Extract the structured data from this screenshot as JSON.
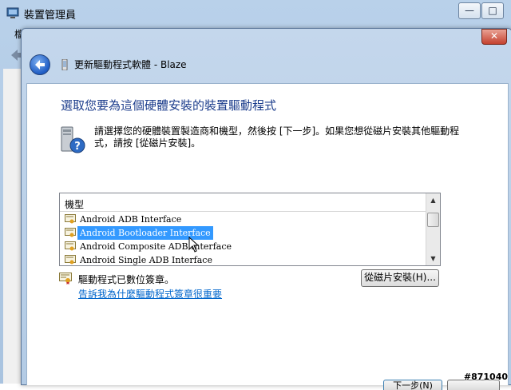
{
  "background_window": {
    "title": "裝置管理員",
    "menu_first": "檔",
    "buttons": {
      "minimize": "—",
      "maximize": "□"
    },
    "app_icon": "device-manager-icon"
  },
  "dialog": {
    "title": "更新驅動程式軟體 - Blaze",
    "close_label": "✕",
    "heading": "選取您要為這個硬體安裝的裝置驅動程式",
    "instruction": "請選擇您的硬體裝置製造商和機型，然後按 [下一步]。如果您想從磁片安裝其他驅動程式，請按 [從磁片安裝]。",
    "list": {
      "column_header": "機型",
      "rows": [
        {
          "label": "Android ADB Interface",
          "selected": false
        },
        {
          "label": "Android Bootloader Interface",
          "selected": true
        },
        {
          "label": "Android Composite ADB Interface",
          "selected": false
        },
        {
          "label": "Android Single ADB Interface",
          "selected": false
        }
      ]
    },
    "signed_text": "驅動程式已數位簽章。",
    "signed_link": "告訴我為什麼驅動程式簽章很重要",
    "have_disk_button": "從磁片安裝(H)...",
    "next_button": "下一步(N)"
  },
  "watermark": "#871040",
  "colors": {
    "heading": "#1c3d8c",
    "selection": "#3399ff",
    "link": "#0066cc"
  }
}
